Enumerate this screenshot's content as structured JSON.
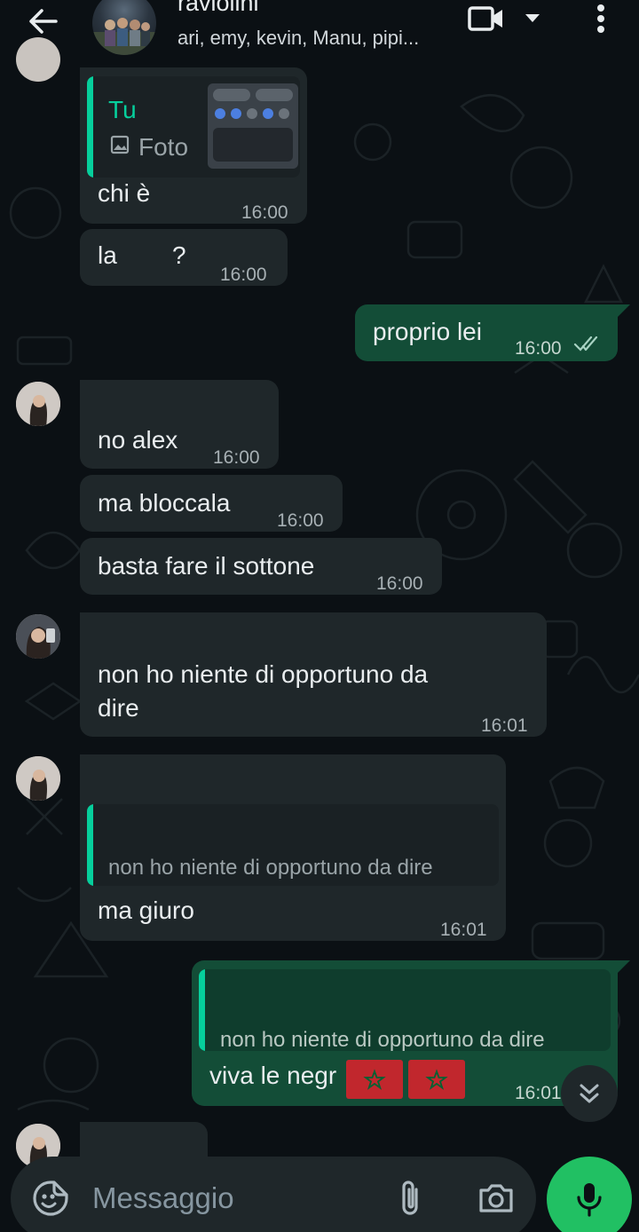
{
  "header": {
    "title": "raviolini",
    "members": "ari, emy, kevin, Manu, pipi..."
  },
  "messages": [
    {
      "id": "m1",
      "direction": "in",
      "quote_author": "Tu",
      "quote_label": "Foto",
      "text": "chi è",
      "time": "16:00"
    },
    {
      "id": "m2",
      "direction": "in",
      "text": "la        ?",
      "time": "16:00"
    },
    {
      "id": "m3",
      "direction": "out",
      "text": "proprio lei",
      "time": "16:00",
      "status": "read"
    },
    {
      "id": "m4",
      "direction": "in",
      "text": "no alex",
      "time": "16:00"
    },
    {
      "id": "m5",
      "direction": "in",
      "text": "ma bloccala",
      "time": "16:00"
    },
    {
      "id": "m6",
      "direction": "in",
      "text": "basta fare il sottone",
      "time": "16:00"
    },
    {
      "id": "m7",
      "direction": "in",
      "text_line1": "non ho niente di opportuno da",
      "text_line2": "dire",
      "time": "16:01"
    },
    {
      "id": "m8",
      "direction": "in",
      "quote_text": "non ho niente di opportuno da dire",
      "text": "ma giuro",
      "time": "16:01"
    },
    {
      "id": "m9",
      "direction": "out",
      "quote_text": "non ho niente di opportuno da dire",
      "text": "viva le negr",
      "time": "16:01"
    }
  ],
  "input": {
    "placeholder": "Messaggio"
  },
  "icons": {
    "back": "arrow-left-icon",
    "video": "video-camera-icon",
    "menu": "more-vertical-icon",
    "emoji": "sticker-icon",
    "attach": "paperclip-icon",
    "camera": "camera-icon",
    "mic": "microphone-icon",
    "scroll": "double-chevron-down-icon"
  },
  "colors": {
    "background": "#0b1014",
    "incoming_bubble": "#1f272a",
    "outgoing_bubble": "#134d37",
    "accent": "#21c063",
    "quote_bar": "#06cf9c",
    "read_ticks": "#a7d2c2"
  }
}
